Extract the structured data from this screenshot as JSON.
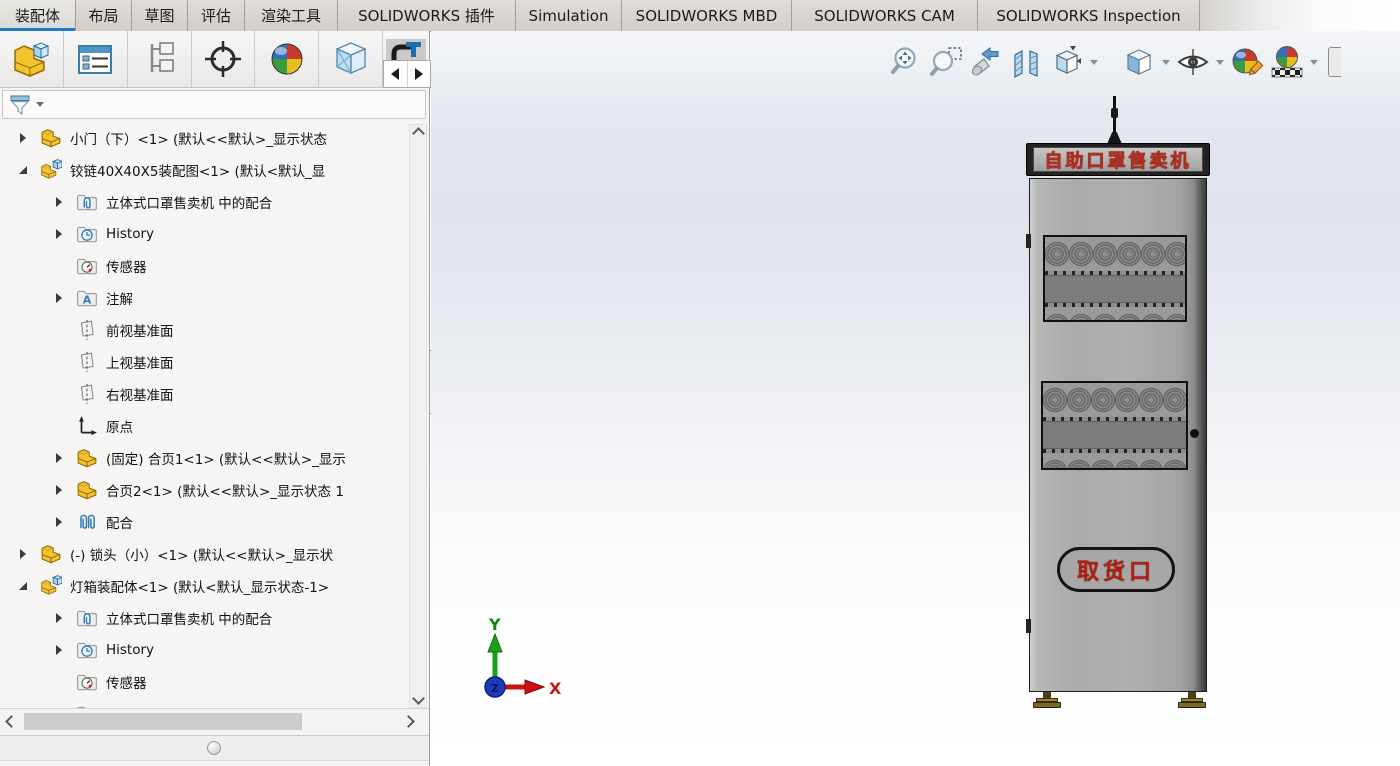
{
  "tab_bar": {
    "tabs": [
      {
        "label": "装配体",
        "active": true
      },
      {
        "label": "布局",
        "active": false
      },
      {
        "label": "草图",
        "active": false
      },
      {
        "label": "评估",
        "active": false
      },
      {
        "label": "渲染工具",
        "active": false
      },
      {
        "label": "SOLIDWORKS 插件",
        "active": false
      },
      {
        "label": "Simulation",
        "active": false
      },
      {
        "label": "SOLIDWORKS MBD",
        "active": false
      },
      {
        "label": "SOLIDWORKS CAM",
        "active": false
      },
      {
        "label": "SOLIDWORKS Inspection",
        "active": false
      }
    ]
  },
  "command_toolbar": {
    "icons": [
      "assembly-part",
      "component-list",
      "component-pattern",
      "smart-target",
      "appearance-sphere",
      "glass-cube",
      "clamp-fixture"
    ],
    "flyout_arrows": [
      "left",
      "right"
    ]
  },
  "headsup_toolbar": {
    "icons": [
      {
        "name": "zoom-to-fit",
        "dropdown": false
      },
      {
        "name": "zoom-to-area",
        "dropdown": false
      },
      {
        "name": "previous-view",
        "dropdown": false
      },
      {
        "name": "section-view",
        "dropdown": false
      },
      {
        "name": "view-orientation",
        "dropdown": true
      },
      {
        "name": "display-style",
        "dropdown": true
      },
      {
        "name": "hide-show-items",
        "dropdown": true
      },
      {
        "name": "edit-appearance",
        "dropdown": false
      },
      {
        "name": "apply-scene",
        "dropdown": true
      },
      {
        "name": "view-settings",
        "dropdown": false
      }
    ]
  },
  "feature_panel": {
    "filter_icon": "filter-funnel",
    "tree": [
      {
        "level": 0,
        "arrow": "collapsed",
        "icon": "part",
        "label": "小门（下）<1> (默认<<默认>_显示状态"
      },
      {
        "level": 0,
        "arrow": "expanded",
        "icon": "assembly",
        "label": "铰链40X40X5装配图<1> (默认<默认_显"
      },
      {
        "level": 1,
        "arrow": "collapsed",
        "icon": "mates-folder",
        "label": "立体式口罩售卖机 中的配合"
      },
      {
        "level": 1,
        "arrow": "collapsed",
        "icon": "history-folder",
        "label": "History"
      },
      {
        "level": 1,
        "arrow": "none",
        "icon": "sensors-folder",
        "label": "传感器"
      },
      {
        "level": 1,
        "arrow": "collapsed",
        "icon": "annotations-folder",
        "label": "注解"
      },
      {
        "level": 1,
        "arrow": "none",
        "icon": "plane",
        "label": "前视基准面"
      },
      {
        "level": 1,
        "arrow": "none",
        "icon": "plane",
        "label": "上视基准面"
      },
      {
        "level": 1,
        "arrow": "none",
        "icon": "plane",
        "label": "右视基准面"
      },
      {
        "level": 1,
        "arrow": "none",
        "icon": "origin",
        "label": "原点"
      },
      {
        "level": 1,
        "arrow": "collapsed",
        "icon": "part",
        "label": "(固定) 合页1<1> (默认<<默认>_显示"
      },
      {
        "level": 1,
        "arrow": "collapsed",
        "icon": "part",
        "label": "合页2<1> (默认<<默认>_显示状态 1"
      },
      {
        "level": 1,
        "arrow": "collapsed",
        "icon": "mates",
        "label": "配合"
      },
      {
        "level": 0,
        "arrow": "collapsed",
        "icon": "part",
        "label": "(-) 锁头（小）<1> (默认<<默认>_显示状"
      },
      {
        "level": 0,
        "arrow": "expanded",
        "icon": "assembly",
        "label": "灯箱装配体<1> (默认<默认_显示状态-1>"
      },
      {
        "level": 1,
        "arrow": "collapsed",
        "icon": "mates-folder",
        "label": "立体式口罩售卖机 中的配合"
      },
      {
        "level": 1,
        "arrow": "collapsed",
        "icon": "history-folder",
        "label": "History"
      },
      {
        "level": 1,
        "arrow": "none",
        "icon": "sensors-folder",
        "label": "传感器"
      },
      {
        "level": 1,
        "arrow": "none",
        "icon": "folder",
        "label": ""
      }
    ]
  },
  "viewport": {
    "machine": {
      "header_text": "自助口罩售卖机",
      "pickup_text": "取货口"
    },
    "triad": {
      "x": "X",
      "y": "Y",
      "z": "Z"
    }
  },
  "colors": {
    "active_tab_underline": "#1e7bc4",
    "machine_text_red": "#b22012",
    "axis_x_red": "#cc1111",
    "axis_y_green": "#18a018",
    "axis_z_blue": "#2244cc",
    "paperclip_blue": "#2e7cb8",
    "part_yellow": "#f6c330"
  }
}
